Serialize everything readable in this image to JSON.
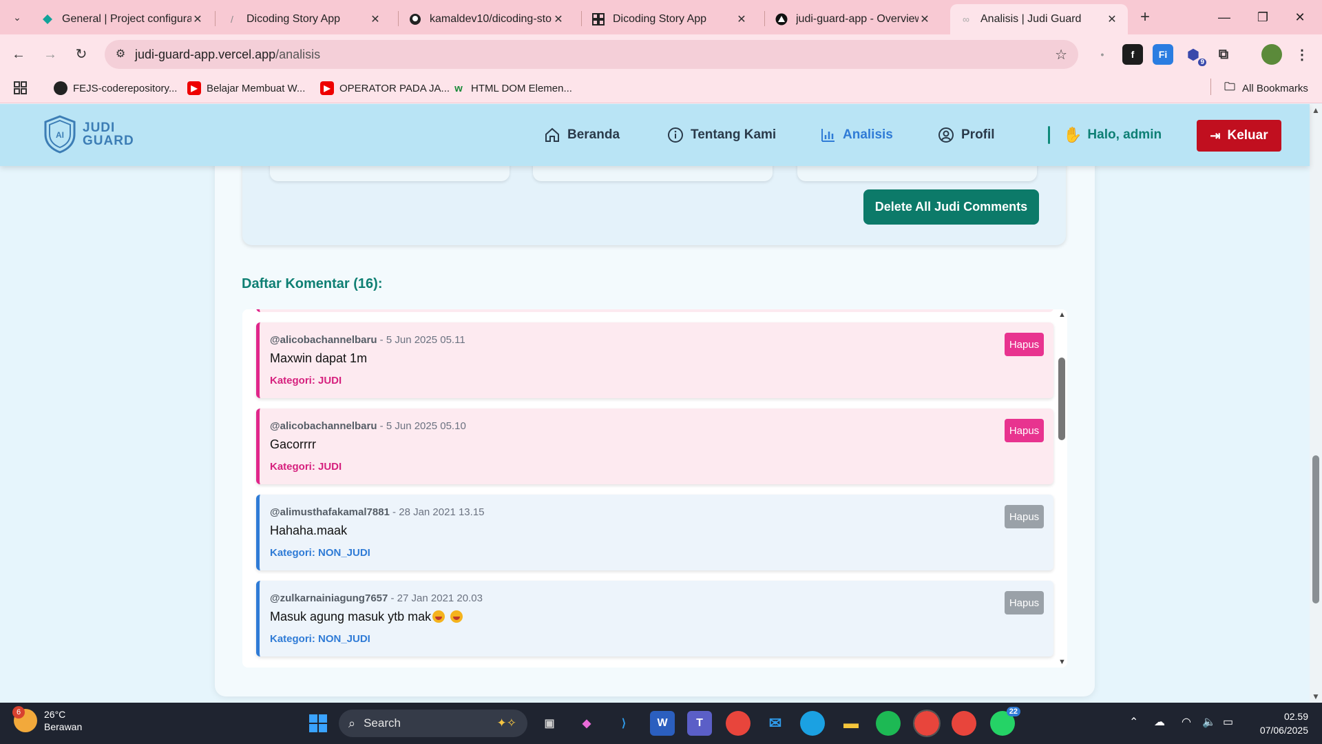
{
  "browser": {
    "tabs": [
      {
        "title": "General | Project configura",
        "icon": "diamond-icon"
      },
      {
        "title": "Dicoding Story App",
        "icon": "feather-icon"
      },
      {
        "title": "kamaldev10/dicoding-stor",
        "icon": "github-icon"
      },
      {
        "title": "Dicoding Story App",
        "icon": "grid-icon"
      },
      {
        "title": "judi-guard-app - Overview",
        "icon": "vercel-icon"
      },
      {
        "title": "Analisis | Judi Guard",
        "icon": "loading-icon"
      }
    ],
    "url_host": "judi-guard-app.vercel.app",
    "url_path": "/analisis",
    "extension_badge": "9",
    "bookmarks": [
      {
        "label": "FEJS-coderepository...",
        "icon": "github-icon"
      },
      {
        "label": "Belajar Membuat W...",
        "icon": "youtube-icon"
      },
      {
        "label": "OPERATOR PADA JA...",
        "icon": "youtube-icon"
      },
      {
        "label": "HTML DOM Elemen...",
        "icon": "w3schools-icon"
      }
    ],
    "all_bookmarks": "All Bookmarks"
  },
  "app": {
    "logo_line1": "JUDI",
    "logo_line2": "GUARD",
    "nav": {
      "home": "Beranda",
      "about": "Tentang Kami",
      "analysis": "Analisis",
      "profile": "Profil"
    },
    "greeting": "Halo, admin",
    "logout": "Keluar",
    "delete_all": "Delete All Judi Comments",
    "list_title": "Daftar Komentar (16):",
    "comments": [
      {
        "user": "@alicobachannelbaru",
        "time": " - 5 Jun 2025 05.11",
        "text": "Maxwin dapat 1m",
        "category": "Kategori: JUDI",
        "type": "judi",
        "delete": "Hapus"
      },
      {
        "user": "@alicobachannelbaru",
        "time": " - 5 Jun 2025 05.10",
        "text": "Gacorrrr",
        "category": "Kategori: JUDI",
        "type": "judi",
        "delete": "Hapus"
      },
      {
        "user": "@alimusthafakamal7881",
        "time": " - 28 Jan 2021 13.15",
        "text": "Hahaha.maak",
        "category": "Kategori: NON_JUDI",
        "type": "non",
        "delete": "Hapus"
      },
      {
        "user": "@zulkarnainiagung7657",
        "time": " - 27 Jan 2021 20.03",
        "text": "Masuk agung masuk ytb mak",
        "category": "Kategori: NON_JUDI",
        "type": "non",
        "delete": "Hapus"
      }
    ]
  },
  "taskbar": {
    "weather_temp": "26°C",
    "weather_desc": "Berawan",
    "weather_badge": "6",
    "search": "Search",
    "whatsapp_badge": "22",
    "time": "02.59",
    "date": "07/06/2025"
  },
  "colors": {
    "judi_accent": "#e0268a",
    "non_judi_accent": "#2f7bd6",
    "primary_green": "#0c7a69",
    "logout_red": "#c10f1f"
  }
}
